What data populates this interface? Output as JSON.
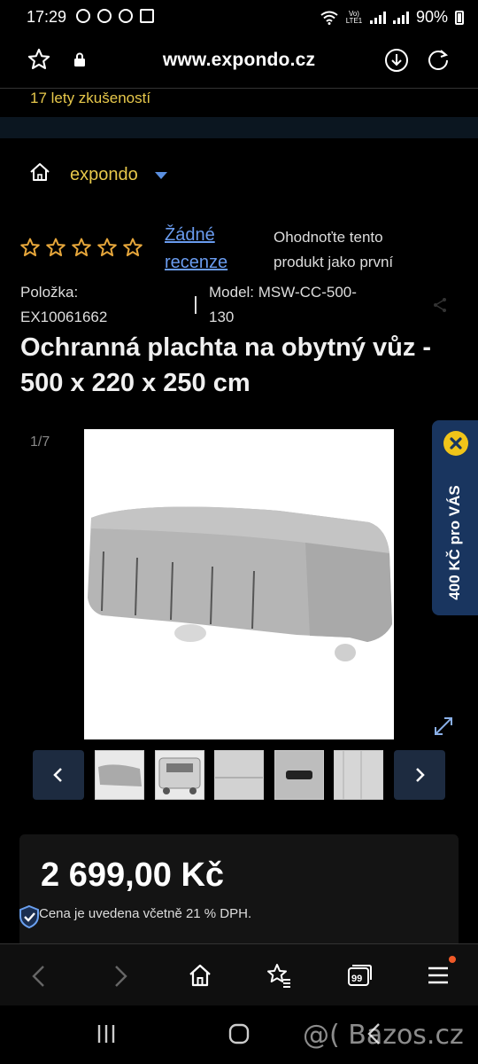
{
  "status": {
    "time": "17:29",
    "battery": "90%",
    "lte": "Vo) LTE1"
  },
  "browser": {
    "url": "www.expondo.cz"
  },
  "tagline": "17 lety zkušeností",
  "breadcrumb": {
    "brand": "expondo"
  },
  "rating": {
    "stars": 0,
    "max": 5,
    "reviews_line1": "Žádné",
    "reviews_line2": "recenze",
    "rate_line1": "Ohodnoťte tento",
    "rate_line2": "produkt jako první"
  },
  "product": {
    "item_label": "Položka:",
    "item_value": "EX10061662",
    "model_line1": "Model: MSW-CC-500-",
    "model_line2": "130",
    "title": "Ochranná plachta na obytný vůz - 500 x 220 x 250 cm",
    "image_counter": "1/7",
    "price": "2 699,00 Kč",
    "vat_note": "Cena je uvedena včetně 21 % DPH."
  },
  "promo": {
    "text": "400 KČ pro VÁS"
  },
  "watermark": "@( Bazos.cz",
  "colors": {
    "accent_yellow": "#e7c84b",
    "link_blue": "#6a9cf0",
    "promo_bg": "#19355f",
    "thumb_nav_bg": "#1d2b40"
  }
}
